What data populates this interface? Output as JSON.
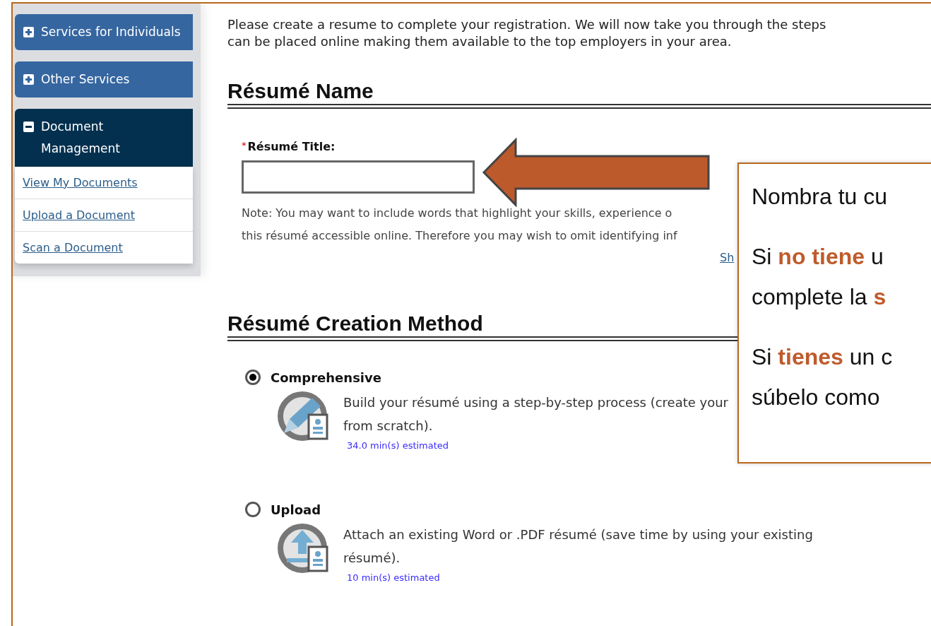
{
  "sidebar": {
    "items": [
      {
        "label": "Services for Individuals",
        "expanded": false
      },
      {
        "label": "Other Services",
        "expanded": false
      },
      {
        "label": "Document Management",
        "expanded": true,
        "children": [
          "View My Documents",
          "Upload a Document",
          "Scan a Document"
        ]
      }
    ]
  },
  "intro": [
    "Please create a resume to complete your registration. We will now take you through the steps",
    "can be placed online making them available to the top employers in your area."
  ],
  "name_section": {
    "heading": "Résumé Name",
    "field_label": "Résumé Title:",
    "required_mark": "*",
    "placeholder_note": [
      "Note: You may want to include words that highlight your skills, experience o",
      "this résumé accessible online. Therefore you may wish to omit identifying inf"
    ],
    "link": "Sh"
  },
  "method_section": {
    "heading": "Résumé Creation Method",
    "options": [
      {
        "kind": "build",
        "label": "Comprehensive",
        "selected": true,
        "description": [
          "Build your résumé using a step-by-step process (create your",
          "from scratch)."
        ],
        "estimate": "34.0 min(s) estimated"
      },
      {
        "kind": "upload",
        "label": "Upload",
        "selected": false,
        "description": [
          "Attach an existing Word or .PDF résumé (save time by using your existing",
          "résumé)."
        ],
        "estimate": "10 min(s) estimated"
      }
    ]
  },
  "callout": {
    "paragraphs": [
      [
        "Nombra tu cu"
      ],
      [
        "Si **no tiene** u",
        "complete la **s**"
      ],
      [
        "Si **tienes** un c",
        "súbelo como"
      ]
    ]
  }
}
